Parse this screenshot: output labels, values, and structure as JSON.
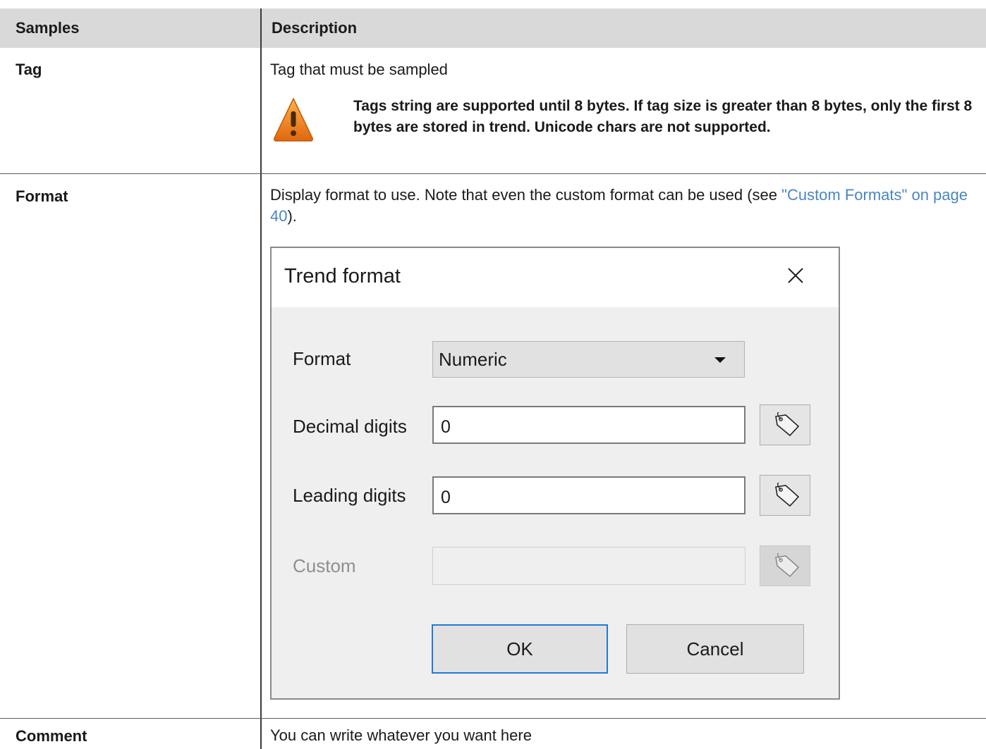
{
  "table": {
    "headers": {
      "col1": "Samples",
      "col2": "Description"
    },
    "rows": {
      "tag": {
        "label": "Tag",
        "description": "Tag that must be sampled",
        "warning": "Tags string are supported until 8 bytes. If tag size is greater than 8 bytes, only the first 8 bytes are stored in trend. Unicode chars are not supported."
      },
      "format": {
        "label": "Format",
        "description_prefix": "Display format to use. Note that even the custom format can be used (see ",
        "description_link": "\"Custom Formats\" on page 40",
        "description_suffix": ")."
      },
      "comment": {
        "label": "Comment",
        "description": "You can write whatever you want here"
      }
    }
  },
  "dialog": {
    "title": "Trend format",
    "format_label": "Format",
    "format_value": "Numeric",
    "decimal_label": "Decimal digits",
    "decimal_value": "0",
    "leading_label": "Leading digits",
    "leading_value": "0",
    "custom_label": "Custom",
    "custom_value": "",
    "ok_label": "OK",
    "cancel_label": "Cancel"
  },
  "icons": {
    "warning": "warning-icon",
    "close": "close-icon",
    "tag": "tag-icon"
  },
  "colors": {
    "header_bg": "#d9d9d9",
    "link": "#4a86c4",
    "warning_orange": "#f08a1c",
    "focus_blue": "#1f7ad6"
  }
}
